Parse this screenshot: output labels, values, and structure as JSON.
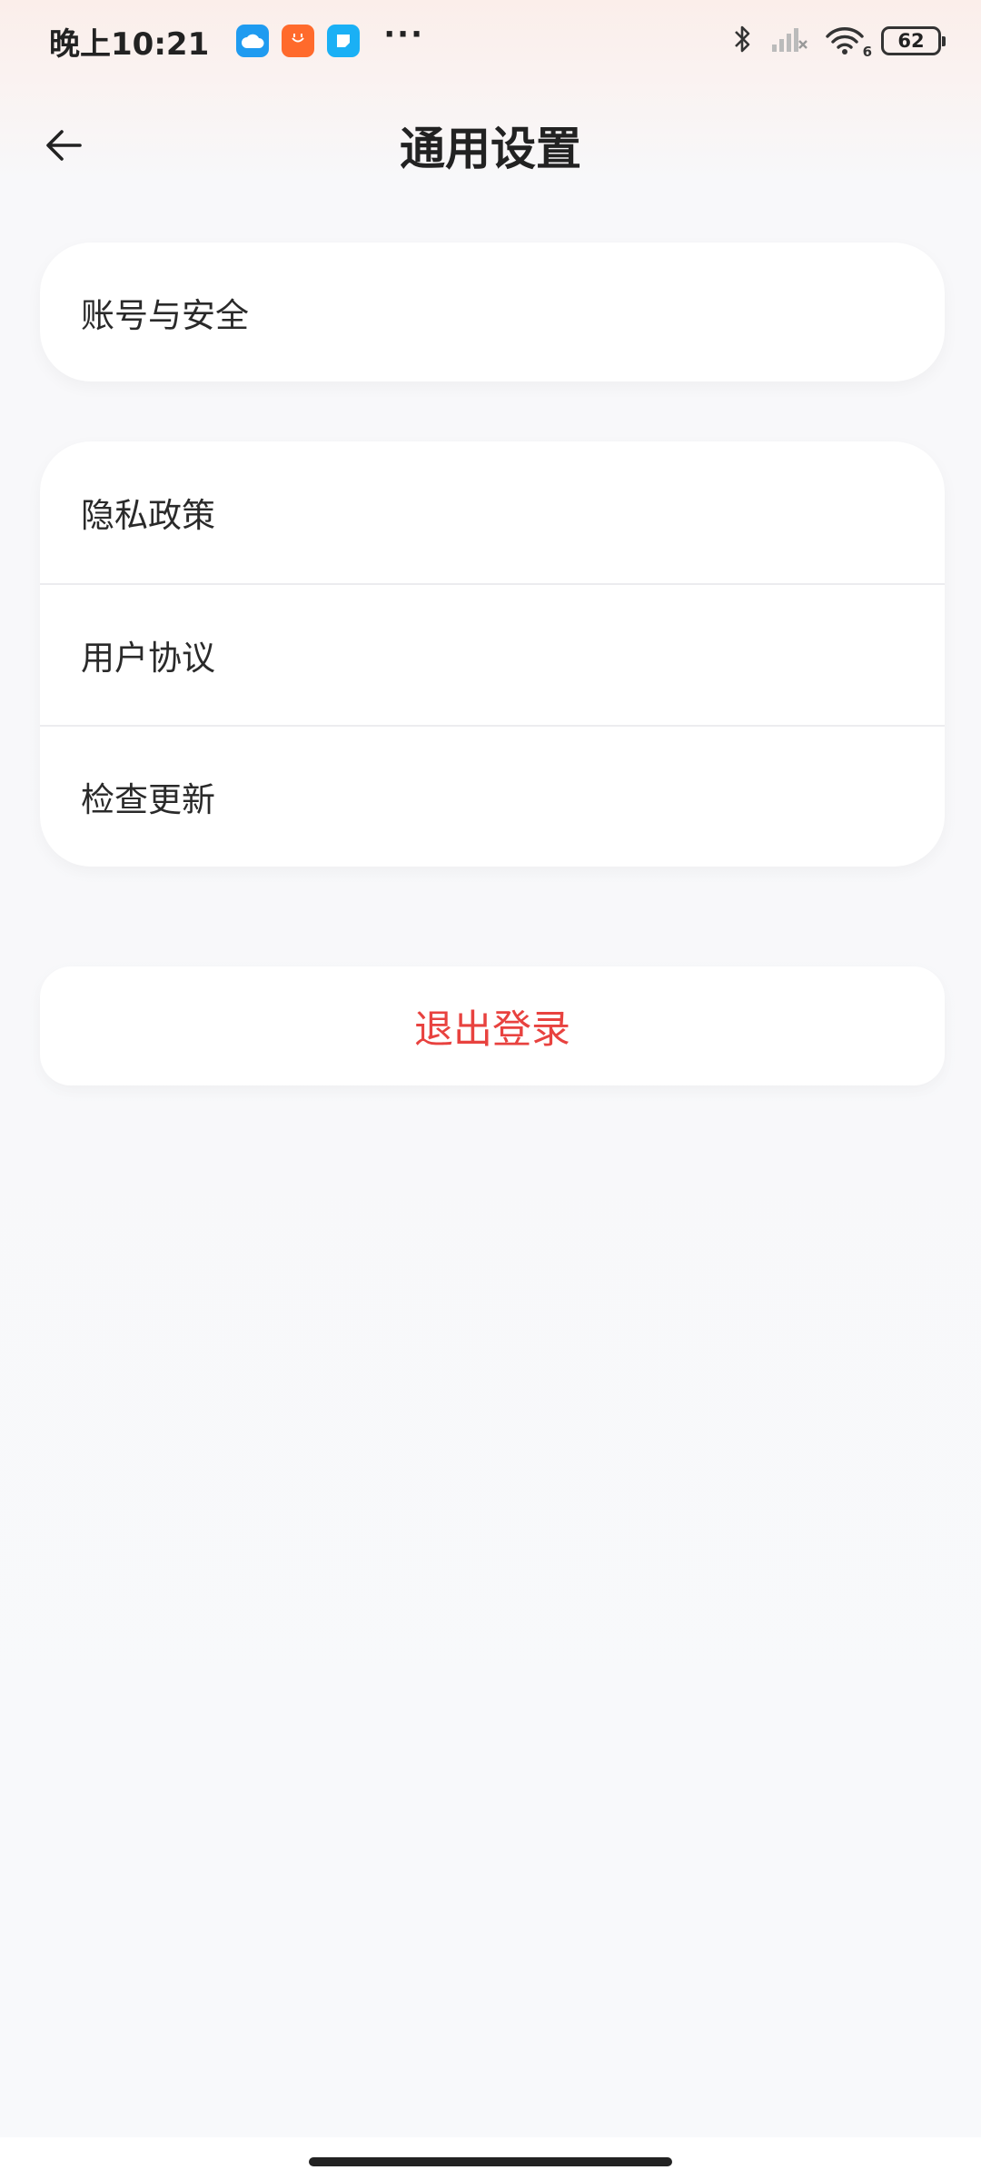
{
  "status_bar": {
    "time": "晚上10:21",
    "more": "···",
    "battery_level": "62",
    "icons": [
      "cloud-app-icon",
      "shop-app-icon",
      "note-app-icon",
      "bluetooth-icon",
      "signal-icon",
      "wifi-icon",
      "battery-icon"
    ],
    "wifi_badge": "6"
  },
  "header": {
    "title": "通用设置",
    "back_icon": "arrow-left-icon"
  },
  "account_section": {
    "items": [
      {
        "label": "账号与安全"
      }
    ]
  },
  "legal_section": {
    "items": [
      {
        "label": "隐私政策"
      },
      {
        "label": "用户协议"
      },
      {
        "label": "检查更新"
      }
    ]
  },
  "logout": {
    "label": "退出登录",
    "color": "#e8423f"
  },
  "colors": {
    "background": "#f8f9fb",
    "card": "#ffffff",
    "text": "#222222",
    "danger": "#e8423f"
  }
}
